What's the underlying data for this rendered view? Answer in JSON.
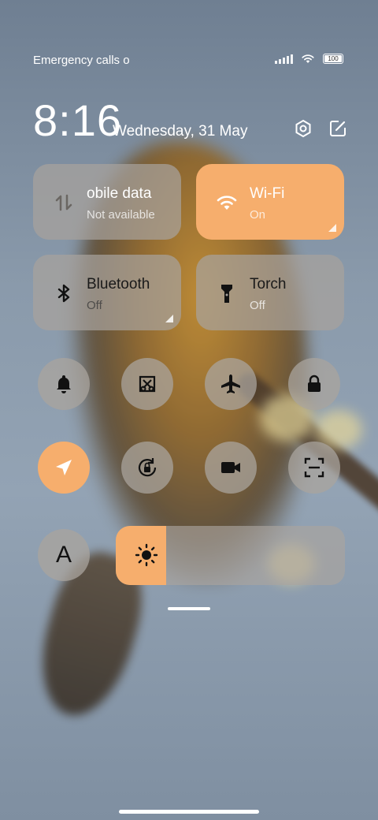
{
  "status": {
    "carrier_text": "Emergency calls o",
    "battery": "100"
  },
  "header": {
    "time": "8:16",
    "date": "Wednesday, 31 May"
  },
  "tiles": {
    "mobile_data": {
      "title": "obile data",
      "subtitle": "Not available"
    },
    "wifi": {
      "title": "Wi-Fi",
      "subtitle": "On"
    },
    "bluetooth": {
      "title": "Bluetooth",
      "subtitle": "Off"
    },
    "torch": {
      "title": "Torch",
      "subtitle": "Off"
    }
  },
  "toggles": [
    "bell-icon",
    "screenshot-icon",
    "airplane-icon",
    "lock-icon",
    "location-icon",
    "rotation-lock-icon",
    "video-camera-icon",
    "scan-icon"
  ],
  "font_size_label": "A",
  "brightness": {
    "level": 0.22
  },
  "colors": {
    "accent": "#f6ae6d",
    "tile_inactive": "#a8a29c"
  }
}
